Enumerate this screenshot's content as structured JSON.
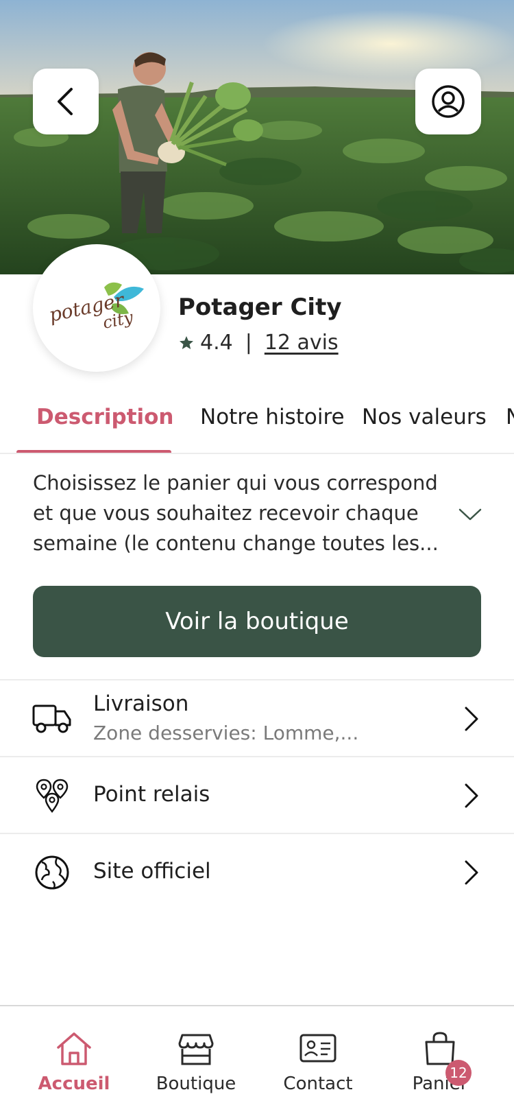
{
  "shop": {
    "name": "Potager City",
    "rating": "4.4",
    "separator": "|",
    "reviews_label": "12 avis",
    "logo_text_1": "potager",
    "logo_text_2": "city"
  },
  "tabs": [
    {
      "label": "Description",
      "active": true
    },
    {
      "label": "Notre histoire",
      "active": false
    },
    {
      "label": "Nos valeurs",
      "active": false
    },
    {
      "label": "N",
      "active": false
    }
  ],
  "description": {
    "text": "Choisissez le panier qui vous correspond et que vous souhaitez recevoir chaque semaine (le contenu change toutes les..."
  },
  "shop_button": {
    "label": "Voir la boutique"
  },
  "info_rows": [
    {
      "title": "Livraison",
      "subtitle": "Zone desservies: Lomme,...",
      "icon": "truck-icon"
    },
    {
      "title": "Point relais",
      "icon": "map-pins-icon"
    },
    {
      "title": "Site officiel",
      "icon": "globe-icon"
    }
  ],
  "bottom_nav": [
    {
      "label": "Accueil",
      "icon": "home-icon",
      "active": true
    },
    {
      "label": "Boutique",
      "icon": "store-icon",
      "active": false
    },
    {
      "label": "Contact",
      "icon": "contact-card-icon",
      "active": false
    },
    {
      "label": "Panier",
      "icon": "shopping-bag-icon",
      "active": false,
      "badge": "12"
    }
  ],
  "colors": {
    "accent": "#cc5a70",
    "primary_button": "#3a5446",
    "text": "#1f1f1f",
    "muted": "#7a7a7a"
  }
}
